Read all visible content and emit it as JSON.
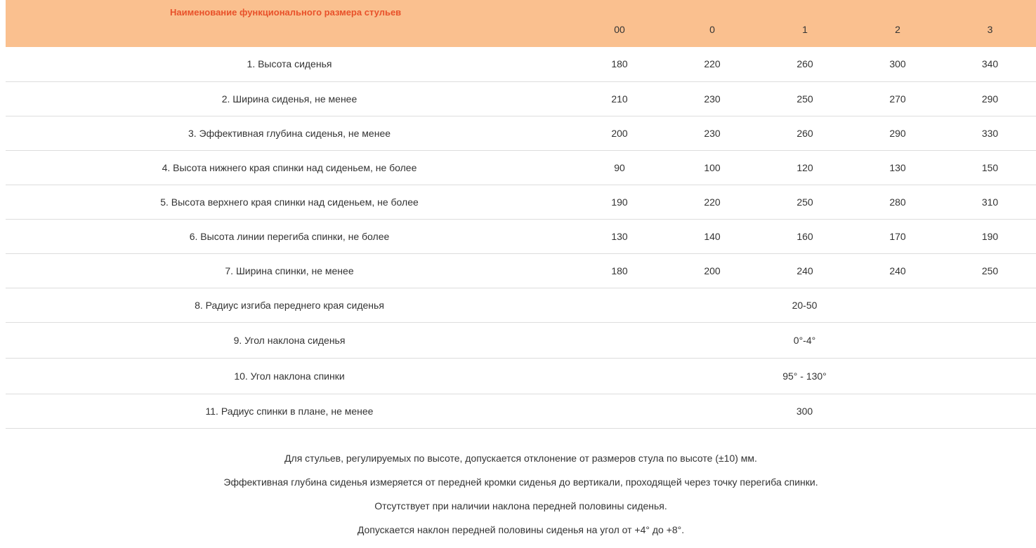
{
  "table": {
    "header": {
      "name": "Наименование функционального размера стульев",
      "sizes": [
        "00",
        "0",
        "1",
        "2",
        "3"
      ]
    },
    "rows": [
      {
        "name": "1. Высота сиденья",
        "values": [
          "180",
          "220",
          "260",
          "300",
          "340"
        ]
      },
      {
        "name": "2. Ширина сиденья, не менее",
        "values": [
          "210",
          "230",
          "250",
          "270",
          "290"
        ]
      },
      {
        "name": "3. Эффективная глубина сиденья, не менее",
        "values": [
          "200",
          "230",
          "260",
          "290",
          "330"
        ]
      },
      {
        "name": "4. Высота нижнего края спинки над сиденьем, не более",
        "values": [
          "90",
          "100",
          "120",
          "130",
          "150"
        ]
      },
      {
        "name": "5. Высота верхнего края спинки над сиденьем, не более",
        "values": [
          "190",
          "220",
          "250",
          "280",
          "310"
        ]
      },
      {
        "name": "6. Высота линии перегиба спинки, не более",
        "values": [
          "130",
          "140",
          "160",
          "170",
          "190"
        ]
      },
      {
        "name": "7. Ширина спинки, не менее",
        "values": [
          "180",
          "200",
          "240",
          "240",
          "250"
        ]
      }
    ],
    "merged_rows": [
      {
        "name": "8. Радиус изгиба переднего края сиденья",
        "value": "20-50"
      },
      {
        "name": "9. Угол наклона сиденья",
        "value": "0°-4°"
      },
      {
        "name": "10. Угол наклона спинки",
        "value": "95° - 130°"
      },
      {
        "name": "11. Радиус спинки в плане, не менее",
        "value": "300"
      }
    ]
  },
  "notes": [
    "Для стульев, регулируемых по высоте, допускается отклонение от размеров стула по высоте (±10) мм.",
    "Эффективная глубина сиденья измеряется от передней кромки сиденья до вертикали, проходящей через точку перегиба спинки.",
    "Отсутствует при наличии наклона передней половины сиденья.",
    "Допускается наклон передней половины сиденья на угол от +4° до +8°."
  ],
  "colors": {
    "header_bg": "#fac08f",
    "header_title": "#e8512a",
    "text": "#333333",
    "row_border": "#dddddd"
  }
}
